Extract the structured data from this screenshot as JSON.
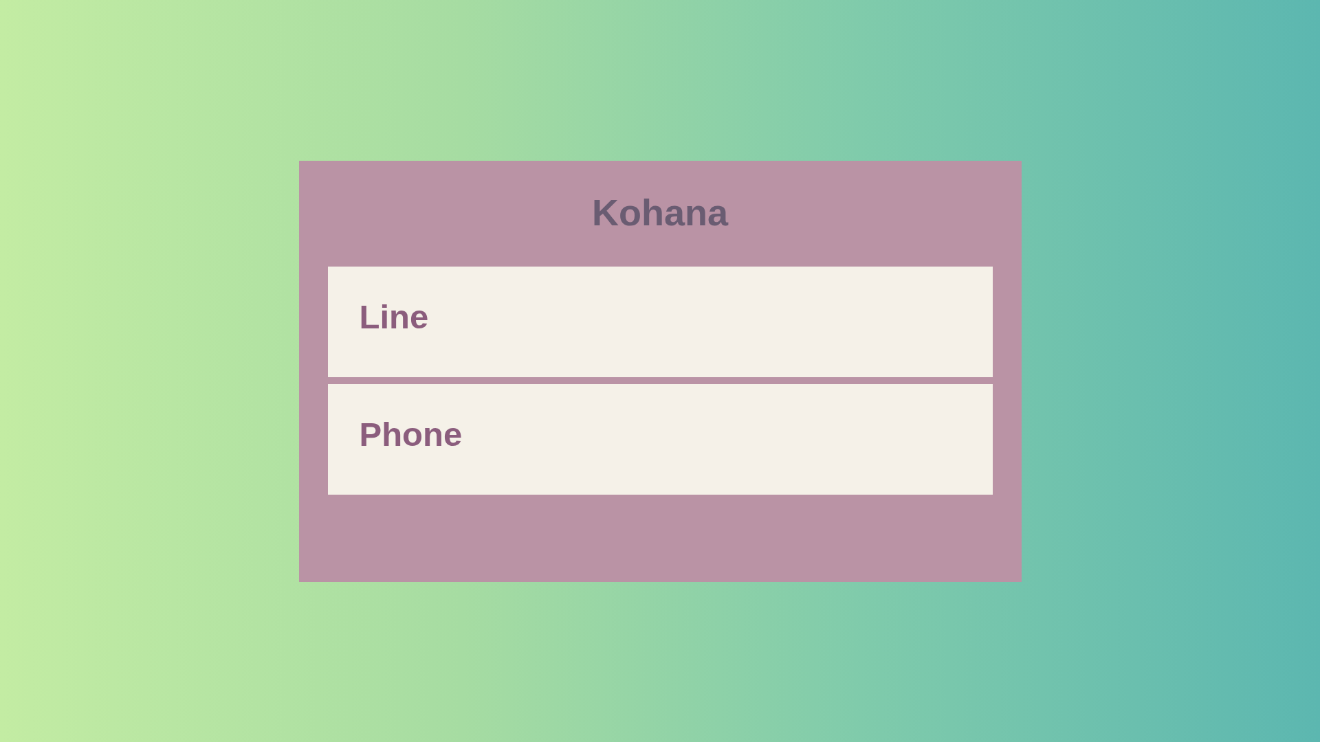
{
  "form": {
    "title": "Kohana",
    "fields": [
      {
        "label": "Line"
      },
      {
        "label": "Phone"
      }
    ]
  }
}
